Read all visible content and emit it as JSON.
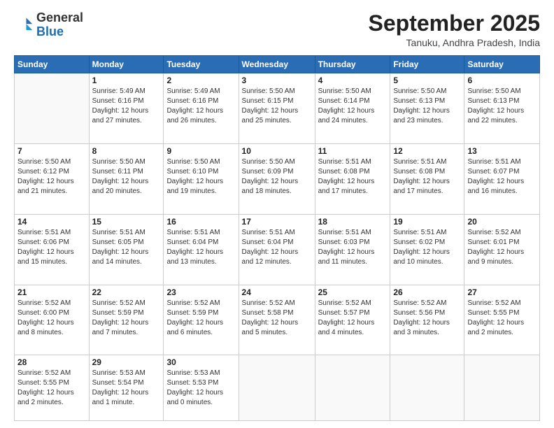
{
  "logo": {
    "general": "General",
    "blue": "Blue"
  },
  "title": "September 2025",
  "subtitle": "Tanuku, Andhra Pradesh, India",
  "days_header": [
    "Sunday",
    "Monday",
    "Tuesday",
    "Wednesday",
    "Thursday",
    "Friday",
    "Saturday"
  ],
  "weeks": [
    [
      {
        "num": "",
        "info": ""
      },
      {
        "num": "1",
        "info": "Sunrise: 5:49 AM\nSunset: 6:16 PM\nDaylight: 12 hours\nand 27 minutes."
      },
      {
        "num": "2",
        "info": "Sunrise: 5:49 AM\nSunset: 6:16 PM\nDaylight: 12 hours\nand 26 minutes."
      },
      {
        "num": "3",
        "info": "Sunrise: 5:50 AM\nSunset: 6:15 PM\nDaylight: 12 hours\nand 25 minutes."
      },
      {
        "num": "4",
        "info": "Sunrise: 5:50 AM\nSunset: 6:14 PM\nDaylight: 12 hours\nand 24 minutes."
      },
      {
        "num": "5",
        "info": "Sunrise: 5:50 AM\nSunset: 6:13 PM\nDaylight: 12 hours\nand 23 minutes."
      },
      {
        "num": "6",
        "info": "Sunrise: 5:50 AM\nSunset: 6:13 PM\nDaylight: 12 hours\nand 22 minutes."
      }
    ],
    [
      {
        "num": "7",
        "info": "Sunrise: 5:50 AM\nSunset: 6:12 PM\nDaylight: 12 hours\nand 21 minutes."
      },
      {
        "num": "8",
        "info": "Sunrise: 5:50 AM\nSunset: 6:11 PM\nDaylight: 12 hours\nand 20 minutes."
      },
      {
        "num": "9",
        "info": "Sunrise: 5:50 AM\nSunset: 6:10 PM\nDaylight: 12 hours\nand 19 minutes."
      },
      {
        "num": "10",
        "info": "Sunrise: 5:50 AM\nSunset: 6:09 PM\nDaylight: 12 hours\nand 18 minutes."
      },
      {
        "num": "11",
        "info": "Sunrise: 5:51 AM\nSunset: 6:08 PM\nDaylight: 12 hours\nand 17 minutes."
      },
      {
        "num": "12",
        "info": "Sunrise: 5:51 AM\nSunset: 6:08 PM\nDaylight: 12 hours\nand 17 minutes."
      },
      {
        "num": "13",
        "info": "Sunrise: 5:51 AM\nSunset: 6:07 PM\nDaylight: 12 hours\nand 16 minutes."
      }
    ],
    [
      {
        "num": "14",
        "info": "Sunrise: 5:51 AM\nSunset: 6:06 PM\nDaylight: 12 hours\nand 15 minutes."
      },
      {
        "num": "15",
        "info": "Sunrise: 5:51 AM\nSunset: 6:05 PM\nDaylight: 12 hours\nand 14 minutes."
      },
      {
        "num": "16",
        "info": "Sunrise: 5:51 AM\nSunset: 6:04 PM\nDaylight: 12 hours\nand 13 minutes."
      },
      {
        "num": "17",
        "info": "Sunrise: 5:51 AM\nSunset: 6:04 PM\nDaylight: 12 hours\nand 12 minutes."
      },
      {
        "num": "18",
        "info": "Sunrise: 5:51 AM\nSunset: 6:03 PM\nDaylight: 12 hours\nand 11 minutes."
      },
      {
        "num": "19",
        "info": "Sunrise: 5:51 AM\nSunset: 6:02 PM\nDaylight: 12 hours\nand 10 minutes."
      },
      {
        "num": "20",
        "info": "Sunrise: 5:52 AM\nSunset: 6:01 PM\nDaylight: 12 hours\nand 9 minutes."
      }
    ],
    [
      {
        "num": "21",
        "info": "Sunrise: 5:52 AM\nSunset: 6:00 PM\nDaylight: 12 hours\nand 8 minutes."
      },
      {
        "num": "22",
        "info": "Sunrise: 5:52 AM\nSunset: 5:59 PM\nDaylight: 12 hours\nand 7 minutes."
      },
      {
        "num": "23",
        "info": "Sunrise: 5:52 AM\nSunset: 5:59 PM\nDaylight: 12 hours\nand 6 minutes."
      },
      {
        "num": "24",
        "info": "Sunrise: 5:52 AM\nSunset: 5:58 PM\nDaylight: 12 hours\nand 5 minutes."
      },
      {
        "num": "25",
        "info": "Sunrise: 5:52 AM\nSunset: 5:57 PM\nDaylight: 12 hours\nand 4 minutes."
      },
      {
        "num": "26",
        "info": "Sunrise: 5:52 AM\nSunset: 5:56 PM\nDaylight: 12 hours\nand 3 minutes."
      },
      {
        "num": "27",
        "info": "Sunrise: 5:52 AM\nSunset: 5:55 PM\nDaylight: 12 hours\nand 2 minutes."
      }
    ],
    [
      {
        "num": "28",
        "info": "Sunrise: 5:52 AM\nSunset: 5:55 PM\nDaylight: 12 hours\nand 2 minutes."
      },
      {
        "num": "29",
        "info": "Sunrise: 5:53 AM\nSunset: 5:54 PM\nDaylight: 12 hours\nand 1 minute."
      },
      {
        "num": "30",
        "info": "Sunrise: 5:53 AM\nSunset: 5:53 PM\nDaylight: 12 hours\nand 0 minutes."
      },
      {
        "num": "",
        "info": ""
      },
      {
        "num": "",
        "info": ""
      },
      {
        "num": "",
        "info": ""
      },
      {
        "num": "",
        "info": ""
      }
    ]
  ]
}
